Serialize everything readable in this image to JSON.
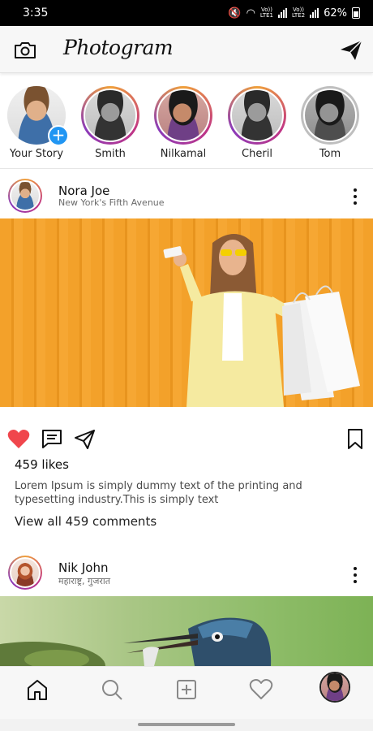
{
  "status_bar": {
    "time": "3:35",
    "network_1": "Vo))",
    "network_1_sub": "LTE1",
    "network_2": "Vo))",
    "network_2_sub": "LTE2",
    "battery": "62%"
  },
  "header": {
    "app_name": "Photogram",
    "left_icon": "camera-icon",
    "right_icon": "send-icon"
  },
  "stories": [
    {
      "label": "Your Story",
      "own": true
    },
    {
      "label": "Smith"
    },
    {
      "label": "Nilkamal"
    },
    {
      "label": "Cheril"
    },
    {
      "label": "Tom"
    }
  ],
  "posts": [
    {
      "user": "Nora Joe",
      "location": "New York's Fifth Avenue",
      "likes": "459 likes",
      "caption": "Lorem Ipsum is simply dummy text of the printing and typesetting industry.This is simply text",
      "view_comments": "View all 459 comments",
      "liked": true
    },
    {
      "user": "Nik John",
      "location": "महाराष्ट्र, गुजरात"
    }
  ],
  "bottom_nav": [
    "home-icon",
    "search-icon",
    "add-post-icon",
    "heart-icon",
    "profile-avatar"
  ],
  "colors": {
    "like_red": "#f0464c",
    "story_ring": "#c13584",
    "add_badge": "#2196f3"
  }
}
